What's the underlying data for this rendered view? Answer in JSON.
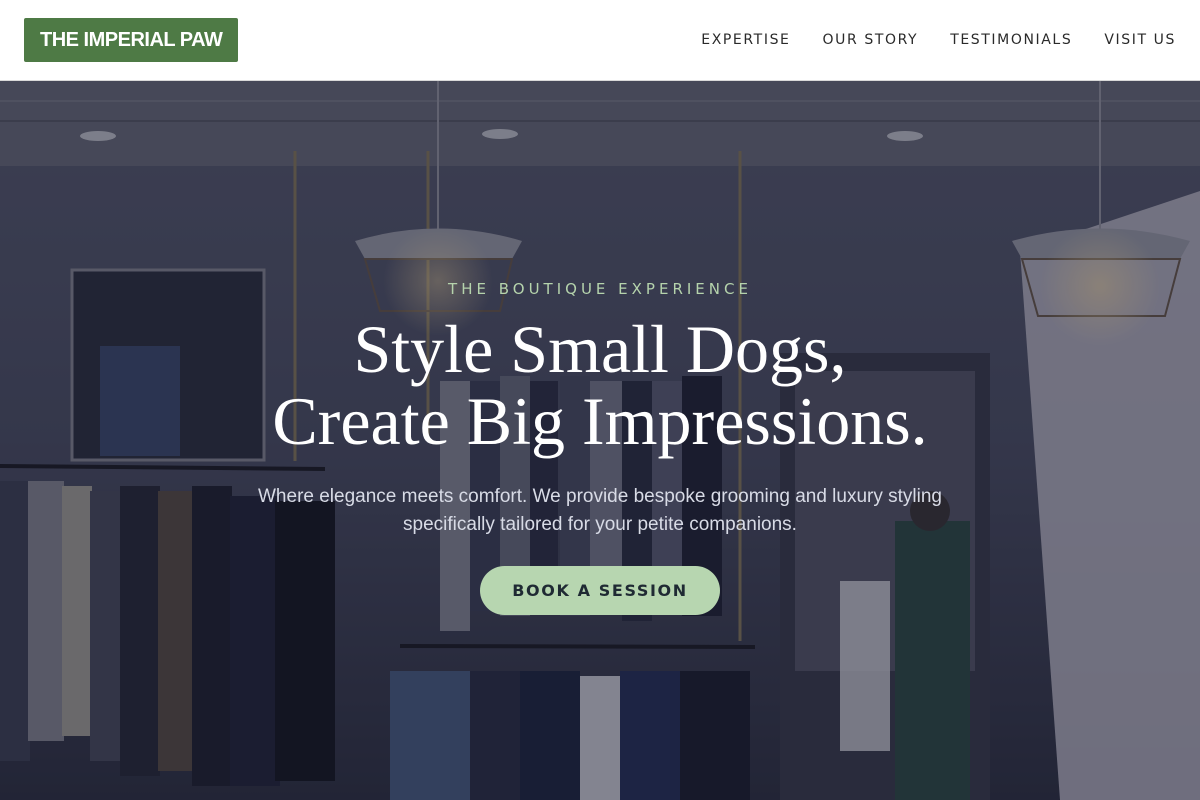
{
  "header": {
    "logo": "THE IMPERIAL PAW",
    "nav": [
      "EXPERTISE",
      "OUR STORY",
      "TESTIMONIALS",
      "VISIT US"
    ]
  },
  "hero": {
    "eyebrow": "THE BOUTIQUE EXPERIENCE",
    "headline_line1": "Style Small Dogs,",
    "headline_line2": "Create Big Impressions.",
    "subtext": "Where elegance meets comfort. We provide bespoke grooming and luxury styling specifically tailored for your petite companions.",
    "cta_label": "BOOK A SESSION",
    "background": "clothing-boutique-photo"
  },
  "colors": {
    "brand_green": "#4e7a45",
    "accent_mint": "#b7d6b0",
    "eyebrow_green": "#b5d3ac"
  }
}
